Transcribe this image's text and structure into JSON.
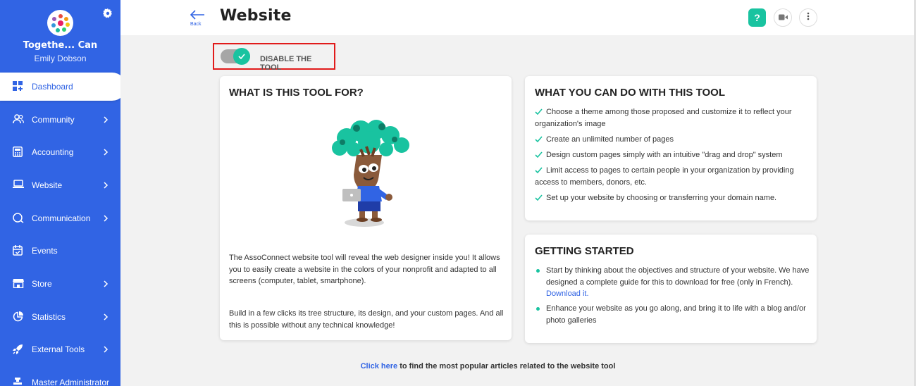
{
  "sidebar": {
    "org_name": "Togethe... Can",
    "user_name": "Emily Dobson",
    "items": [
      {
        "label": "Dashboard",
        "icon": "dashboard-icon",
        "active": true,
        "chevron": false
      },
      {
        "label": "Community",
        "icon": "community-icon",
        "active": false,
        "chevron": true
      },
      {
        "label": "Accounting",
        "icon": "accounting-icon",
        "active": false,
        "chevron": true
      },
      {
        "label": "Website",
        "icon": "laptop-icon",
        "active": false,
        "chevron": true
      },
      {
        "label": "Communication",
        "icon": "chat-icon",
        "active": false,
        "chevron": true
      },
      {
        "label": "Events",
        "icon": "calendar-icon",
        "active": false,
        "chevron": false
      },
      {
        "label": "Store",
        "icon": "store-icon",
        "active": false,
        "chevron": true
      },
      {
        "label": "Statistics",
        "icon": "pie-chart-icon",
        "active": false,
        "chevron": true
      },
      {
        "label": "External Tools",
        "icon": "rocket-icon",
        "active": false,
        "chevron": true
      },
      {
        "label": "Master Administrator",
        "icon": "admin-icon",
        "active": false,
        "chevron": false
      }
    ]
  },
  "header": {
    "back_label": "Back",
    "title": "Website",
    "help_label": "?"
  },
  "toggle": {
    "label": "DISABLE THE TOOL",
    "checked": true
  },
  "card_what": {
    "title": "WHAT IS THIS TOOL FOR?",
    "paragraph1": "The AssoConnect website tool will reveal the web designer inside you! It allows you to easily create a website in the colors of your nonprofit and adapted to all screens (computer, tablet, smartphone).",
    "paragraph2": "Build in a few clicks its tree structure, its design, and your custom pages. And all this is possible without any technical knowledge!"
  },
  "card_can": {
    "title": "WHAT YOU CAN DO WITH THIS TOOL",
    "items": [
      "Choose a theme among those proposed and customize it to reflect your organization's image",
      "Create an unlimited number of pages",
      "Design custom pages simply with an intuitive \"drag and drop\" system",
      "Limit access to pages to certain people in your organization by providing access to members, donors, etc.",
      "Set up your website by choosing or transferring your domain name."
    ]
  },
  "card_start": {
    "title": "GETTING STARTED",
    "item1_text": "Start by thinking about the objectives and structure of your website. We have designed a complete guide for this to download for free (only in French).",
    "item1_link": "Download it.",
    "item2_text": "Enhance your website as you go along, and bring it to life with a blog and/or photo galleries"
  },
  "footer": {
    "link": "Click here",
    "text": " to find the most popular articles related to the website tool"
  },
  "colors": {
    "sidebar": "#3164e4",
    "accent": "#19c3a0",
    "highlight_border": "#e11b1b"
  }
}
